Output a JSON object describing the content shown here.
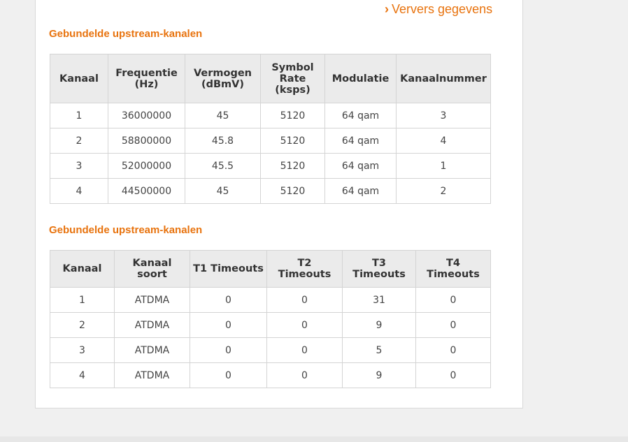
{
  "refresh": {
    "chevron": "›",
    "label": "Ververs gegevens"
  },
  "section1": {
    "title": "Gebundelde upstream-kanalen",
    "headers": [
      "Kanaal",
      "Frequentie (Hz)",
      "Vermogen (dBmV)",
      "Symbol Rate (ksps)",
      "Modulatie",
      "Kanaalnummer"
    ],
    "rows": [
      [
        "1",
        "36000000",
        "45",
        "5120",
        "64 qam",
        "3"
      ],
      [
        "2",
        "58800000",
        "45.8",
        "5120",
        "64 qam",
        "4"
      ],
      [
        "3",
        "52000000",
        "45.5",
        "5120",
        "64 qam",
        "1"
      ],
      [
        "4",
        "44500000",
        "45",
        "5120",
        "64 qam",
        "2"
      ]
    ]
  },
  "section2": {
    "title": "Gebundelde upstream-kanalen",
    "headers": [
      "Kanaal",
      "Kanaal soort",
      "T1 Timeouts",
      "T2 Timeouts",
      "T3 Timeouts",
      "T4 Timeouts"
    ],
    "rows": [
      [
        "1",
        "ATDMA",
        "0",
        "0",
        "31",
        "0"
      ],
      [
        "2",
        "ATDMA",
        "0",
        "0",
        "9",
        "0"
      ],
      [
        "3",
        "ATDMA",
        "0",
        "0",
        "5",
        "0"
      ],
      [
        "4",
        "ATDMA",
        "0",
        "0",
        "9",
        "0"
      ]
    ]
  },
  "colors": {
    "accent": "#e8730e",
    "header_bg": "#ebebeb",
    "border": "#d4d4d4"
  }
}
